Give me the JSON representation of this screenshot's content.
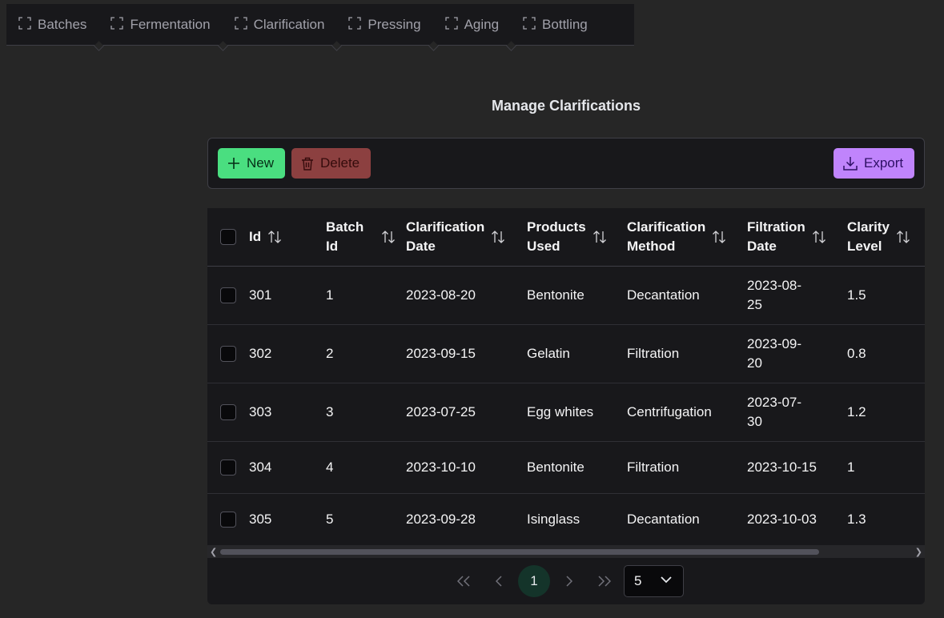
{
  "tabs": [
    {
      "label": "Batches",
      "icon": "focus-frame-icon"
    },
    {
      "label": "Fermentation",
      "icon": "focus-frame-icon"
    },
    {
      "label": "Clarification",
      "icon": "focus-frame-icon"
    },
    {
      "label": "Pressing",
      "icon": "focus-frame-icon"
    },
    {
      "label": "Aging",
      "icon": "focus-frame-icon"
    },
    {
      "label": "Bottling",
      "icon": "focus-frame-icon"
    }
  ],
  "page": {
    "title": "Manage Clarifications"
  },
  "toolbar": {
    "new_label": "New",
    "delete_label": "Delete",
    "export_label": "Export"
  },
  "table": {
    "headers": [
      {
        "l1": "Id",
        "l2": ""
      },
      {
        "l1": "Batch",
        "l2": "Id"
      },
      {
        "l1": "Clarification",
        "l2": "Date"
      },
      {
        "l1": "Products",
        "l2": "Used"
      },
      {
        "l1": "Clarification",
        "l2": "Method"
      },
      {
        "l1": "Filtration",
        "l2": "Date"
      },
      {
        "l1": "Clarity",
        "l2": "Level"
      }
    ],
    "rows": [
      {
        "id": "301",
        "batch_id": "1",
        "clarification_date": "2023-08-20",
        "products_used": "Bentonite",
        "method": "Decantation",
        "filtration_date_l1": "2023-08-",
        "filtration_date_l2": "25",
        "clarity": "1.5"
      },
      {
        "id": "302",
        "batch_id": "2",
        "clarification_date": "2023-09-15",
        "products_used": "Gelatin",
        "method": "Filtration",
        "filtration_date_l1": "2023-09-",
        "filtration_date_l2": "20",
        "clarity": "0.8"
      },
      {
        "id": "303",
        "batch_id": "3",
        "clarification_date": "2023-07-25",
        "products_used": "Egg whites",
        "method": "Centrifugation",
        "filtration_date_l1": "2023-07-",
        "filtration_date_l2": "30",
        "clarity": "1.2"
      },
      {
        "id": "304",
        "batch_id": "4",
        "clarification_date": "2023-10-10",
        "products_used": "Bentonite",
        "method": "Filtration",
        "filtration_date_l1": "2023-10-15",
        "filtration_date_l2": "",
        "clarity": "1"
      },
      {
        "id": "305",
        "batch_id": "5",
        "clarification_date": "2023-09-28",
        "products_used": "Isinglass",
        "method": "Decantation",
        "filtration_date_l1": "2023-10-03",
        "filtration_date_l2": "",
        "clarity": "1.3"
      }
    ]
  },
  "pagination": {
    "current_page": "1",
    "rows_per_page": "5"
  },
  "colors": {
    "new_button": "#4ade80",
    "delete_button": "#a14747",
    "export_button": "#c084fc",
    "active_page": "#14342a"
  }
}
